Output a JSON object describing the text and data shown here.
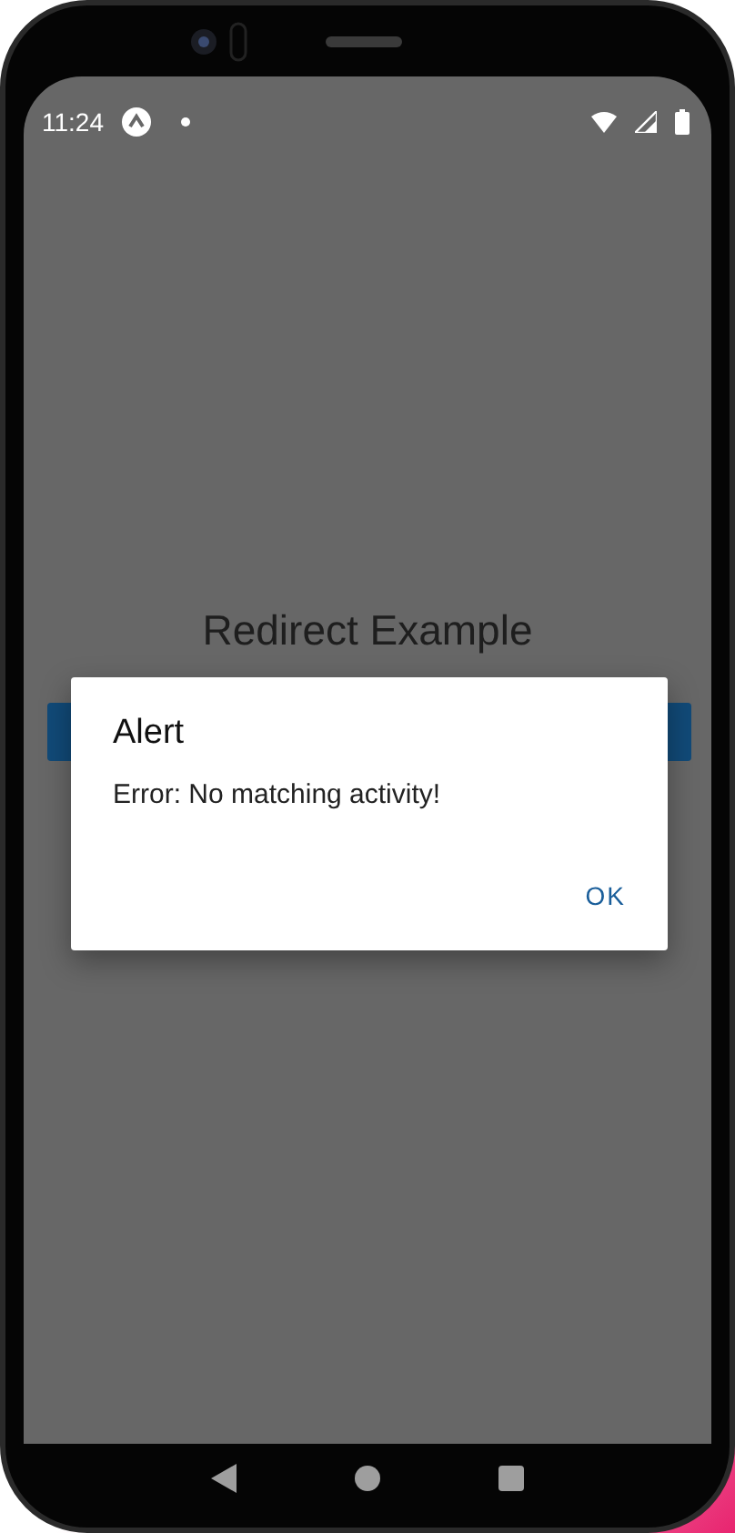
{
  "status_bar": {
    "time": "11:24"
  },
  "app": {
    "title": "Redirect Example"
  },
  "dialog": {
    "title": "Alert",
    "message": "Error: No matching activity!",
    "buttons": [
      "OK"
    ]
  },
  "navigation_bar": {
    "buttons": [
      {
        "kind": "back"
      },
      {
        "kind": "home"
      },
      {
        "kind": "recents"
      }
    ]
  }
}
